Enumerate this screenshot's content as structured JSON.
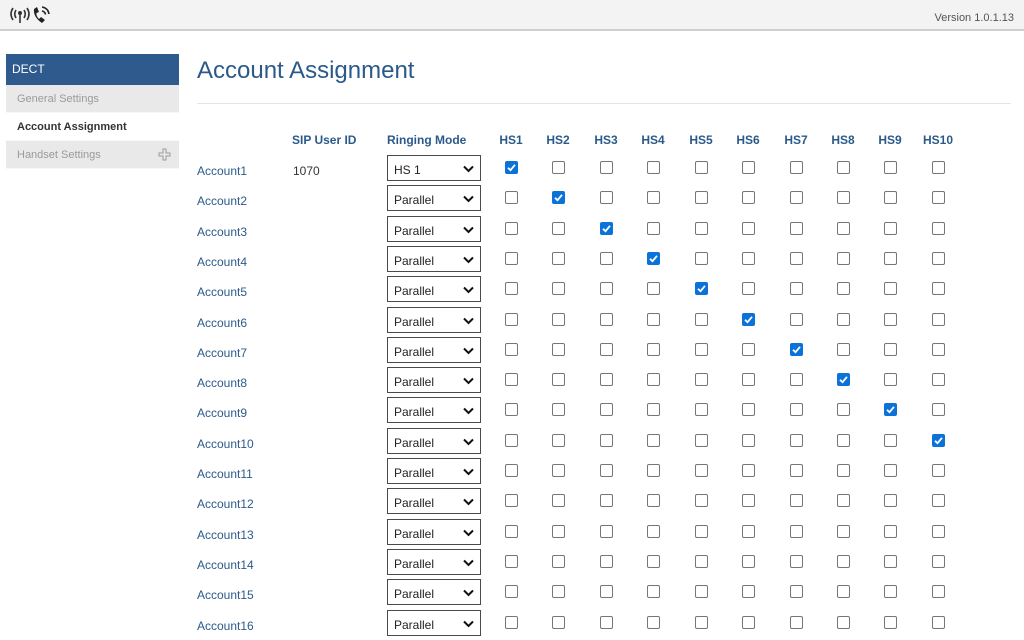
{
  "header": {
    "version": "Version 1.0.1.13",
    "logo_icon": "dect-phone-signal-icon"
  },
  "sidebar": {
    "section": "DECT",
    "items": [
      {
        "label": "General Settings",
        "active": false
      },
      {
        "label": "Account Assignment",
        "active": true
      },
      {
        "label": "Handset Settings",
        "active": false,
        "icon": "plus-icon"
      }
    ]
  },
  "main": {
    "title": "Account Assignment",
    "columns": {
      "sip_user_id": "SIP User ID",
      "ringing_mode": "Ringing Mode",
      "handsets": [
        "HS1",
        "HS2",
        "HS3",
        "HS4",
        "HS5",
        "HS6",
        "HS7",
        "HS8",
        "HS9",
        "HS10"
      ]
    },
    "accounts": [
      {
        "name": "Account1",
        "sip_user_id": "1070",
        "ringing_mode": "HS 1",
        "checked": [
          1
        ]
      },
      {
        "name": "Account2",
        "sip_user_id": "",
        "ringing_mode": "Parallel",
        "checked": [
          2
        ]
      },
      {
        "name": "Account3",
        "sip_user_id": "",
        "ringing_mode": "Parallel",
        "checked": [
          3
        ]
      },
      {
        "name": "Account4",
        "sip_user_id": "",
        "ringing_mode": "Parallel",
        "checked": [
          4
        ]
      },
      {
        "name": "Account5",
        "sip_user_id": "",
        "ringing_mode": "Parallel",
        "checked": [
          5
        ]
      },
      {
        "name": "Account6",
        "sip_user_id": "",
        "ringing_mode": "Parallel",
        "checked": [
          6
        ]
      },
      {
        "name": "Account7",
        "sip_user_id": "",
        "ringing_mode": "Parallel",
        "checked": [
          7
        ]
      },
      {
        "name": "Account8",
        "sip_user_id": "",
        "ringing_mode": "Parallel",
        "checked": [
          8
        ]
      },
      {
        "name": "Account9",
        "sip_user_id": "",
        "ringing_mode": "Parallel",
        "checked": [
          9
        ]
      },
      {
        "name": "Account10",
        "sip_user_id": "",
        "ringing_mode": "Parallel",
        "checked": [
          10
        ]
      },
      {
        "name": "Account11",
        "sip_user_id": "",
        "ringing_mode": "Parallel",
        "checked": []
      },
      {
        "name": "Account12",
        "sip_user_id": "",
        "ringing_mode": "Parallel",
        "checked": []
      },
      {
        "name": "Account13",
        "sip_user_id": "",
        "ringing_mode": "Parallel",
        "checked": []
      },
      {
        "name": "Account14",
        "sip_user_id": "",
        "ringing_mode": "Parallel",
        "checked": []
      },
      {
        "name": "Account15",
        "sip_user_id": "",
        "ringing_mode": "Parallel",
        "checked": []
      },
      {
        "name": "Account16",
        "sip_user_id": "",
        "ringing_mode": "Parallel",
        "checked": []
      }
    ]
  },
  "colors": {
    "accent": "#2f5a8e",
    "link": "#2b5a8a",
    "checkbox_checked": "#0b72d9"
  }
}
